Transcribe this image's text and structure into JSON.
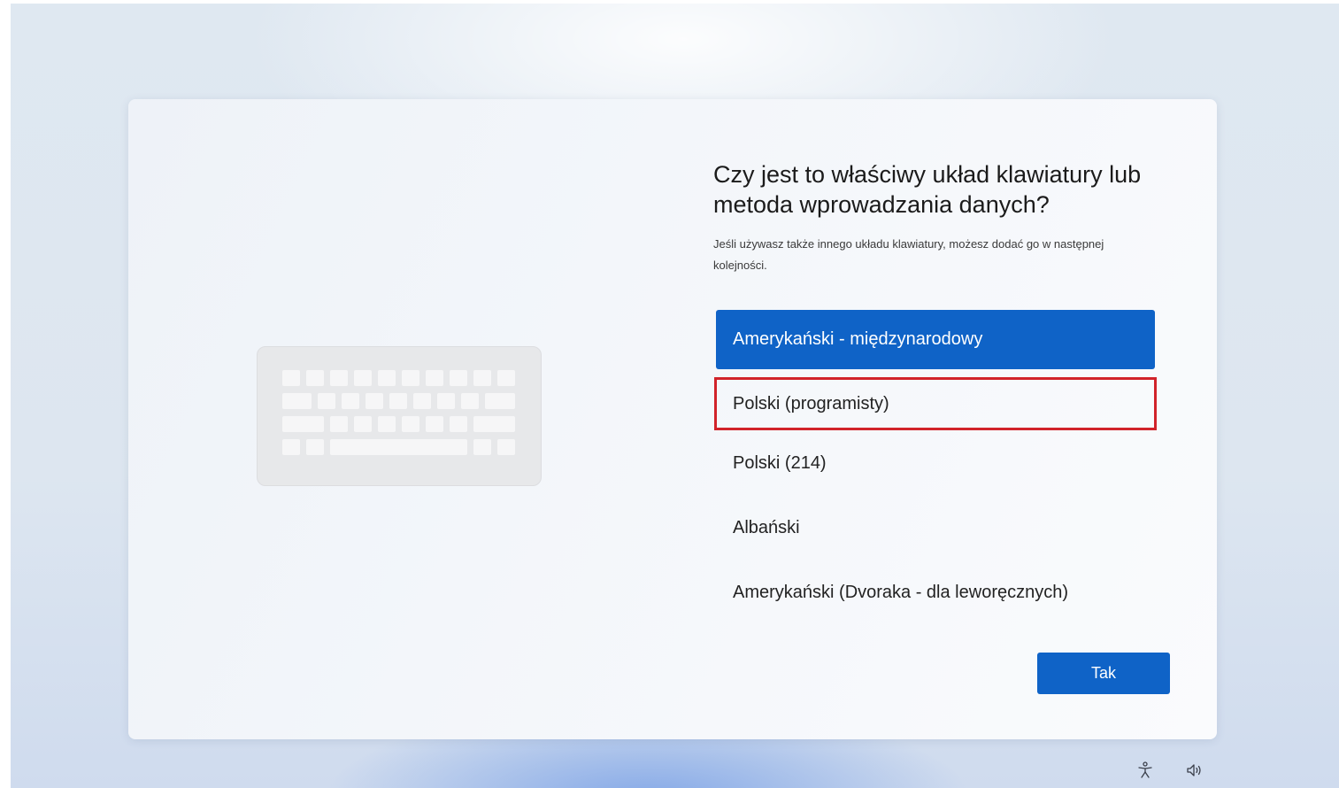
{
  "dialog": {
    "title": "Czy jest to właściwy układ klawiatury lub metoda wprowadzania danych?",
    "subtitle": "Jeśli używasz także innego układu klawiatury, możesz dodać go w następnej kolejności."
  },
  "layouts": [
    {
      "label": "Amerykański - międzynarodowy",
      "state": "selected"
    },
    {
      "label": "Polski (programisty)",
      "state": "highlighted"
    },
    {
      "label": "Polski (214)",
      "state": "normal"
    },
    {
      "label": "Albański",
      "state": "normal"
    },
    {
      "label": "Amerykański (Dvoraka - dla leworęcznych)",
      "state": "normal"
    }
  ],
  "buttons": {
    "confirm_label": "Tak"
  },
  "tray": {
    "icons": [
      "accessibility-icon",
      "volume-icon"
    ]
  },
  "colors": {
    "accent": "#0f63c7",
    "highlight_border": "#d1232a"
  }
}
